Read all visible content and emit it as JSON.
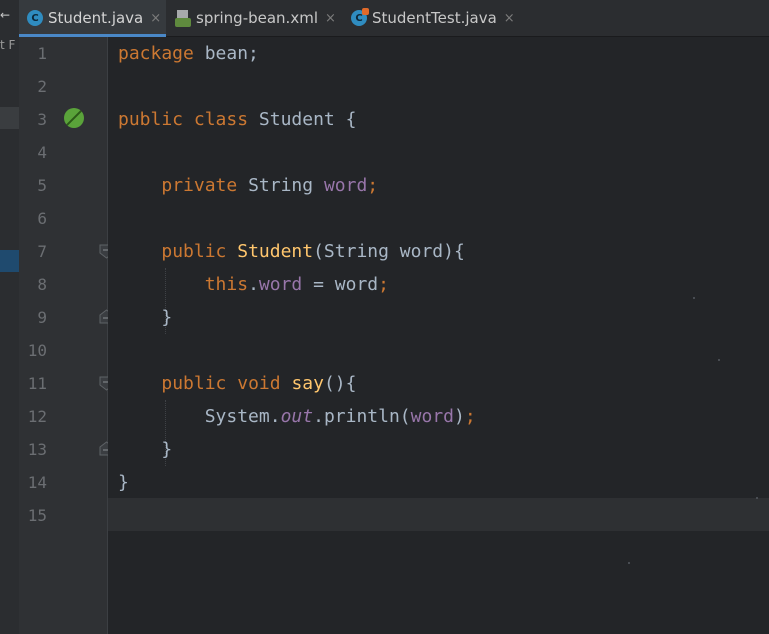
{
  "side_strip": {
    "arrow": "←",
    "fragment": "t F"
  },
  "tabs": [
    {
      "label": "Student.java",
      "active": true,
      "icon": "java-class-icon",
      "icon_letter": "C",
      "close": "×"
    },
    {
      "label": "spring-bean.xml",
      "active": false,
      "icon": "xml-file-icon",
      "close": "×"
    },
    {
      "label": "StudentTest.java",
      "active": false,
      "icon": "java-test-class-icon",
      "icon_letter": "C",
      "close": "×"
    }
  ],
  "line_numbers": [
    "1",
    "2",
    "3",
    "4",
    "5",
    "6",
    "7",
    "8",
    "9",
    "10",
    "11",
    "12",
    "13",
    "14",
    "15"
  ],
  "code": {
    "l1": {
      "kw": "package",
      "rest": " bean;"
    },
    "l3": {
      "kw1": "public",
      "kw2": "class",
      "name": "Student",
      "brace": " {"
    },
    "l5": {
      "kw": "private",
      "type": "String",
      "field": "word",
      "semi": ";"
    },
    "l7": {
      "kw": "public",
      "ctor": "Student",
      "params": "(String word){"
    },
    "l8": {
      "kw": "this",
      "dot": ".",
      "field": "word",
      "rest": " = word",
      "semi": ";"
    },
    "l9": {
      "text": "}"
    },
    "l11": {
      "kw1": "public",
      "kw2": "void",
      "fn": "say",
      "rest": "(){"
    },
    "l12": {
      "cls": "System",
      "dot1": ".",
      "out": "out",
      "dot2": ".",
      "call": "println(",
      "arg": "word",
      "close": ")",
      "semi": ";"
    },
    "l13": {
      "text": "}"
    },
    "l14": {
      "text": "}"
    }
  },
  "colors": {
    "keyword": "#cc7832",
    "field": "#9876aa",
    "method_decl": "#ffc66d",
    "default_text": "#a9b7c6",
    "active_tab_underline": "#4a88c7",
    "bean_gutter_icon": "#5aa33a"
  }
}
